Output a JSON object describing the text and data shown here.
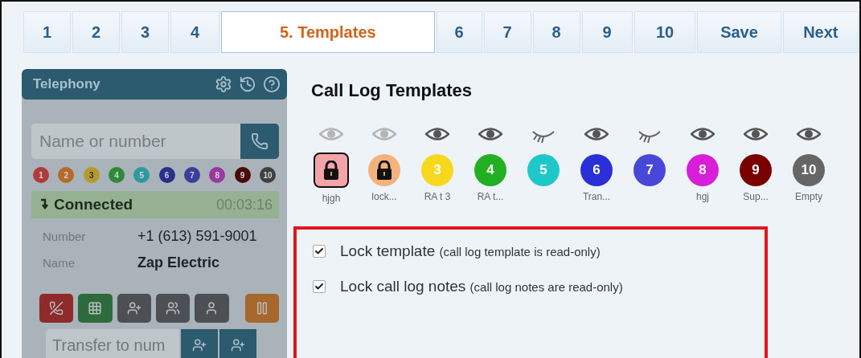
{
  "tabs": [
    {
      "label": "1",
      "selected": false
    },
    {
      "label": "2",
      "selected": false
    },
    {
      "label": "3",
      "selected": false
    },
    {
      "label": "4",
      "selected": false
    },
    {
      "label": "5. Templates",
      "selected": true
    },
    {
      "label": "6",
      "selected": false
    },
    {
      "label": "7",
      "selected": false
    },
    {
      "label": "8",
      "selected": false
    },
    {
      "label": "9",
      "selected": false
    },
    {
      "label": "10",
      "selected": false
    },
    {
      "label": "Save",
      "selected": false
    },
    {
      "label": "Next",
      "selected": false
    }
  ],
  "telephony": {
    "title": "Telephony",
    "search": {
      "placeholder": "Name or number"
    },
    "lines": [
      {
        "label": "1",
        "color": "#b03a3a"
      },
      {
        "label": "2",
        "color": "#b66a2a"
      },
      {
        "label": "3",
        "color": "#b49a2a"
      },
      {
        "label": "4",
        "color": "#2f8a38"
      },
      {
        "label": "5",
        "color": "#2f9a9a"
      },
      {
        "label": "6",
        "color": "#2a2f8a"
      },
      {
        "label": "7",
        "color": "#3a3f9a"
      },
      {
        "label": "8",
        "color": "#9a3aa0"
      },
      {
        "label": "9",
        "color": "#4a0a0a"
      },
      {
        "label": "10",
        "color": "#404040"
      }
    ],
    "status": {
      "label": "Connected",
      "timer": "00:03:16"
    },
    "details": [
      {
        "label": "Number",
        "value": "+1 (613) 591-9001",
        "bold": false
      },
      {
        "label": "Name",
        "value": "Zap Electric",
        "bold": true
      }
    ],
    "actions": [
      {
        "kind": "hangup"
      },
      {
        "kind": "keypad"
      },
      {
        "kind": "add"
      },
      {
        "kind": "conference"
      },
      {
        "kind": "consult"
      },
      {
        "kind": "hold"
      }
    ],
    "transfer": {
      "placeholder": "Transfer to num"
    }
  },
  "templates": {
    "title": "Call Log Templates",
    "items": [
      {
        "kind": "locked",
        "visible": true,
        "faded": true,
        "color": "#f4a4a8",
        "label": "hjgh",
        "selected": true
      },
      {
        "kind": "locked",
        "visible": true,
        "faded": true,
        "color": "#f5b27c",
        "label": "lock...",
        "selected": false
      },
      {
        "kind": "number",
        "number": "3",
        "visible": true,
        "faded": false,
        "color": "#f7d81e",
        "label": "RA t 3",
        "selected": false
      },
      {
        "kind": "number",
        "number": "4",
        "visible": true,
        "faded": false,
        "color": "#22b022",
        "label": "RA t...",
        "selected": false
      },
      {
        "kind": "number",
        "number": "5",
        "visible": false,
        "faded": false,
        "color": "#1fc8c8",
        "selected": false
      },
      {
        "kind": "number",
        "number": "6",
        "visible": true,
        "faded": false,
        "color": "#2b2fd8",
        "label": "Tran...",
        "selected": false
      },
      {
        "kind": "number",
        "number": "7",
        "visible": false,
        "faded": false,
        "color": "#4848d8",
        "selected": false
      },
      {
        "kind": "number",
        "number": "8",
        "visible": true,
        "faded": false,
        "color": "#d81ed8",
        "label": "hgj",
        "selected": false
      },
      {
        "kind": "number",
        "number": "9",
        "visible": true,
        "faded": false,
        "color": "#7a0000",
        "label": "Sup...",
        "selected": false
      },
      {
        "kind": "number",
        "number": "10",
        "visible": true,
        "faded": false,
        "color": "#666666",
        "label": "Empty",
        "selected": false
      }
    ]
  },
  "options": [
    {
      "label": "Lock template",
      "note": "(call log template is read-only)",
      "checked": true
    },
    {
      "label": "Lock call log notes",
      "note": "(call log notes are read-only)",
      "checked": true
    }
  ]
}
